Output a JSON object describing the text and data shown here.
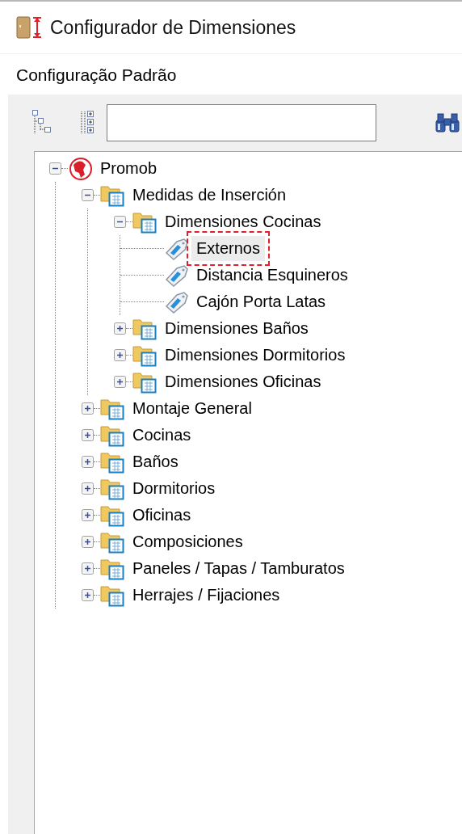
{
  "window": {
    "title": "Configurador de Dimensiones"
  },
  "section_title": "Configuração Padrão",
  "tree": [
    {
      "label": "Promob",
      "kind": "root",
      "expanded": true,
      "selected": false,
      "children": [
        {
          "label": "Medidas de Inserción",
          "kind": "folder",
          "expanded": true,
          "selected": false,
          "children": [
            {
              "label": "Dimensiones Cocinas",
              "kind": "folder",
              "expanded": true,
              "selected": false,
              "children": [
                {
                  "label": "Externos",
                  "kind": "leaf",
                  "selected": true
                },
                {
                  "label": "Distancia Esquineros",
                  "kind": "leaf",
                  "selected": false
                },
                {
                  "label": "Cajón Porta Latas",
                  "kind": "leaf",
                  "selected": false
                }
              ]
            },
            {
              "label": "Dimensiones Baños",
              "kind": "folder",
              "expanded": false,
              "selected": false
            },
            {
              "label": "Dimensiones Dormitorios",
              "kind": "folder",
              "expanded": false,
              "selected": false
            },
            {
              "label": "Dimensiones Oficinas",
              "kind": "folder",
              "expanded": false,
              "selected": false
            }
          ]
        },
        {
          "label": "Montaje General",
          "kind": "folder",
          "expanded": false,
          "selected": false
        },
        {
          "label": "Cocinas",
          "kind": "folder",
          "expanded": false,
          "selected": false
        },
        {
          "label": "Baños",
          "kind": "folder",
          "expanded": false,
          "selected": false
        },
        {
          "label": "Dormitorios",
          "kind": "folder",
          "expanded": false,
          "selected": false
        },
        {
          "label": "Oficinas",
          "kind": "folder",
          "expanded": false,
          "selected": false
        },
        {
          "label": "Composiciones",
          "kind": "folder",
          "expanded": false,
          "selected": false
        },
        {
          "label": "Paneles / Tapas / Tamburatos",
          "kind": "folder",
          "expanded": false,
          "selected": false
        },
        {
          "label": "Herrajes / Fijaciones",
          "kind": "folder",
          "expanded": false,
          "selected": false
        }
      ]
    }
  ]
}
